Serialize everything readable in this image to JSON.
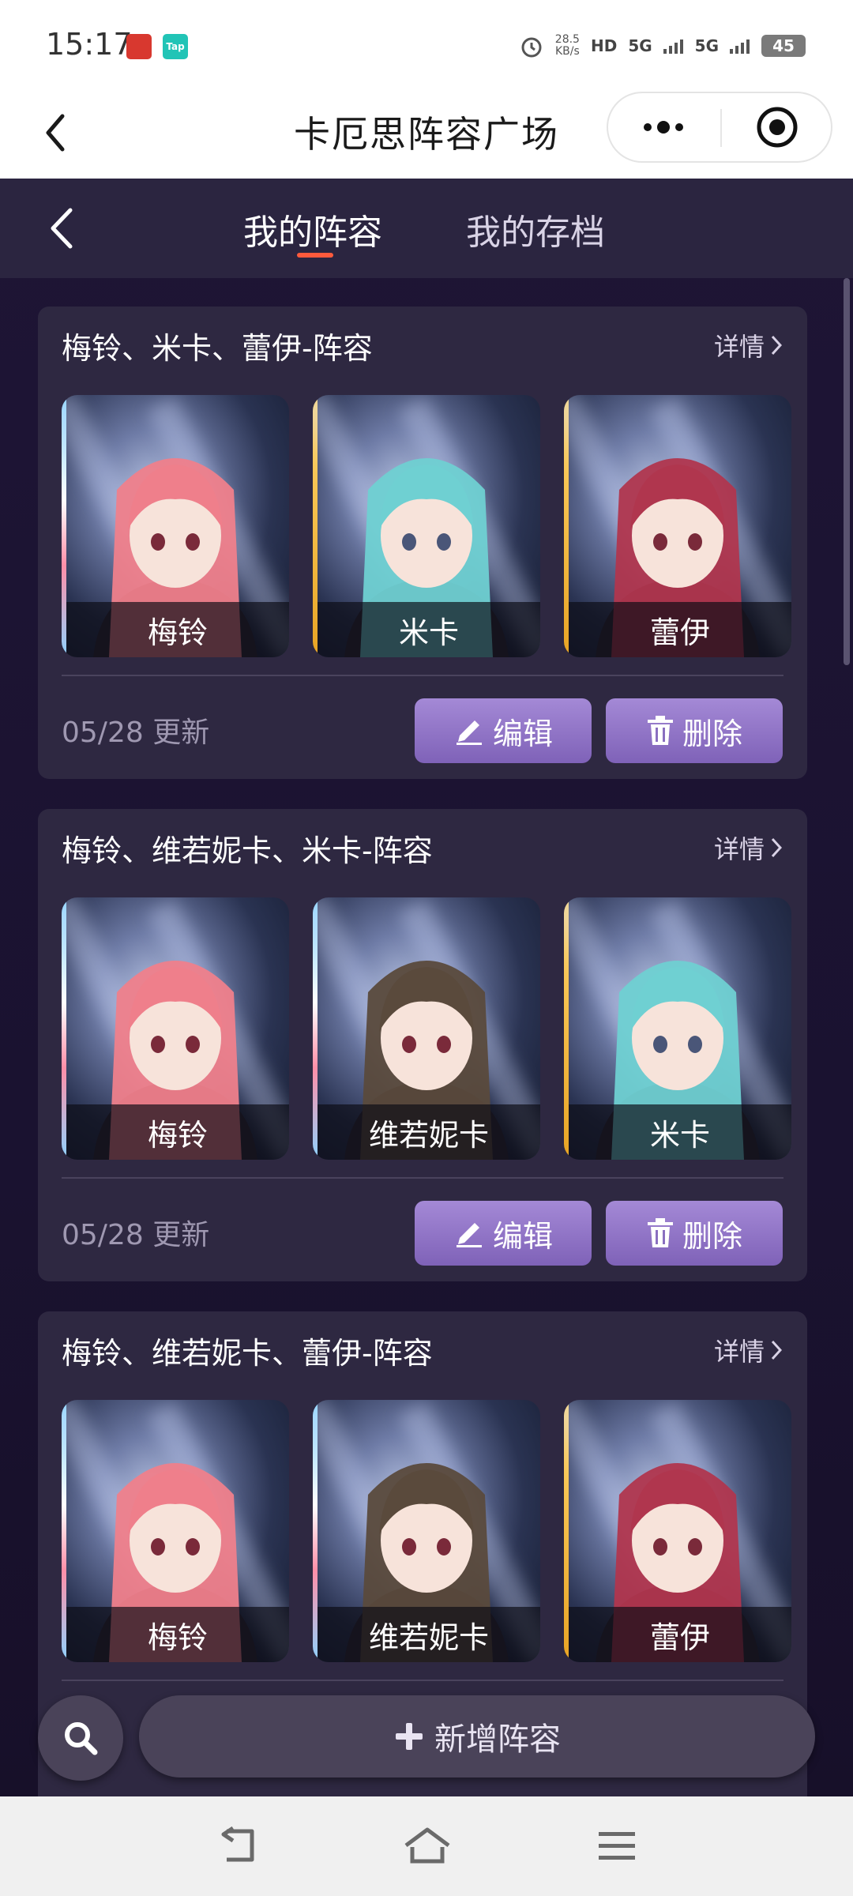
{
  "status_bar": {
    "time": "15:17",
    "badge_1": "",
    "badge_2": "Tap",
    "net_speed": "28.5",
    "net_speed_unit": "KB/s",
    "hd": "HD",
    "sig1": "5G",
    "sig2": "5G",
    "battery": "45"
  },
  "title_bar": {
    "title": "卡厄思阵容广场"
  },
  "tabs": [
    {
      "label": "我的阵容",
      "active": true
    },
    {
      "label": "我的存档",
      "active": false
    }
  ],
  "cards": [
    {
      "title": "梅铃、米卡、蕾伊-阵容",
      "detail": "详情",
      "date": "05/28 更新",
      "edit": "编辑",
      "delete": "删除",
      "characters": [
        {
          "name": "梅铃",
          "hair": "#ef7f8b",
          "stripe": "rainbow"
        },
        {
          "name": "米卡",
          "hair": "#6fd0d2",
          "stripe": "gold"
        },
        {
          "name": "蕾伊",
          "hair": "#b0364e",
          "stripe": "gold"
        }
      ]
    },
    {
      "title": "梅铃、维若妮卡、米卡-阵容",
      "detail": "详情",
      "date": "05/28 更新",
      "edit": "编辑",
      "delete": "删除",
      "characters": [
        {
          "name": "梅铃",
          "hair": "#ef7f8b",
          "stripe": "rainbow"
        },
        {
          "name": "维若妮卡",
          "hair": "#5a4a3c",
          "stripe": "rainbow"
        },
        {
          "name": "米卡",
          "hair": "#6fd0d2",
          "stripe": "gold"
        }
      ]
    },
    {
      "title": "梅铃、维若妮卡、蕾伊-阵容",
      "detail": "详情",
      "characters": [
        {
          "name": "梅铃",
          "hair": "#ef7f8b",
          "stripe": "rainbow"
        },
        {
          "name": "维若妮卡",
          "hair": "#5a4a3c",
          "stripe": "rainbow"
        },
        {
          "name": "蕾伊",
          "hair": "#b0364e",
          "stripe": "gold"
        }
      ]
    }
  ],
  "bottom": {
    "add_label": "新增阵容"
  },
  "colors": {
    "accent_button": "#9277c8",
    "tab_underline": "#ff5a3c",
    "card_bg": "#2e2841"
  }
}
